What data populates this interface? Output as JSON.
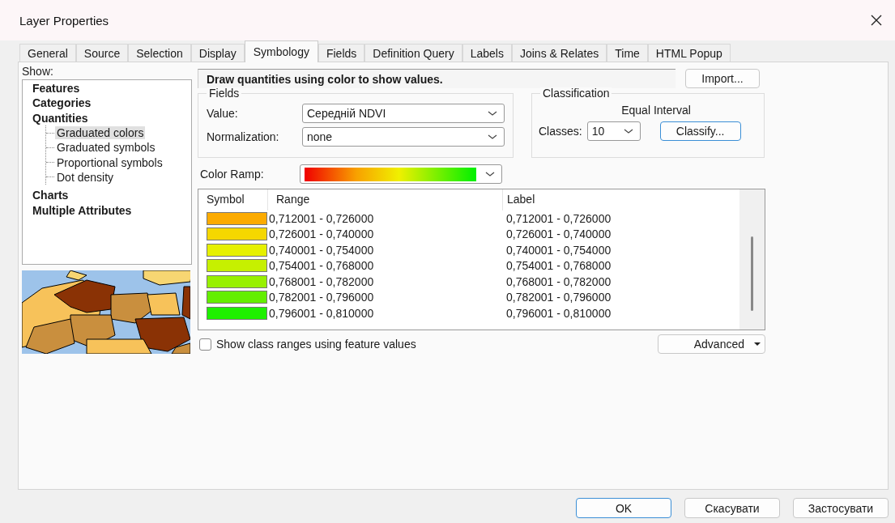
{
  "window": {
    "title": "Layer Properties"
  },
  "tabs": [
    {
      "label": "General",
      "selected": false
    },
    {
      "label": "Source",
      "selected": false
    },
    {
      "label": "Selection",
      "selected": false
    },
    {
      "label": "Display",
      "selected": false
    },
    {
      "label": "Symbology",
      "selected": true
    },
    {
      "label": "Fields",
      "selected": false
    },
    {
      "label": "Definition Query",
      "selected": false
    },
    {
      "label": "Labels",
      "selected": false
    },
    {
      "label": "Joins & Relates",
      "selected": false
    },
    {
      "label": "Time",
      "selected": false
    },
    {
      "label": "HTML Popup",
      "selected": false
    }
  ],
  "show": {
    "label": "Show:",
    "tree": [
      {
        "label": "Features",
        "selected": false
      },
      {
        "label": "Categories",
        "selected": false
      },
      {
        "label": "Quantities",
        "selected": false,
        "children": [
          {
            "label": "Graduated colors",
            "selected": true
          },
          {
            "label": "Graduated symbols",
            "selected": false
          },
          {
            "label": "Proportional symbols",
            "selected": false
          },
          {
            "label": "Dot density",
            "selected": false
          }
        ]
      },
      {
        "label": "Charts",
        "selected": false
      },
      {
        "label": "Multiple Attributes",
        "selected": false
      }
    ]
  },
  "description": "Draw quantities using color to show values.",
  "import_button": "Import...",
  "fields": {
    "title": "Fields",
    "value_label": "Value:",
    "value": "Середній NDVI",
    "normalization_label": "Normalization:",
    "normalization": "none"
  },
  "classification": {
    "title": "Classification",
    "method": "Equal Interval",
    "classes_label": "Classes:",
    "classes": "10",
    "classify_button": {
      "label": "Classify...",
      "focused": true
    }
  },
  "color_ramp": {
    "label": "Color Ramp:"
  },
  "table": {
    "columns": [
      "Symbol",
      "Range",
      "Label"
    ],
    "rows": [
      {
        "color": "#fcab00",
        "range": "0,712001 - 0,726000",
        "label": "0,712001 - 0,726000"
      },
      {
        "color": "#f5d700",
        "range": "0,726001 - 0,740000",
        "label": "0,726001 - 0,740000"
      },
      {
        "color": "#e6f000",
        "range": "0,740001 - 0,754000",
        "label": "0,740001 - 0,754000"
      },
      {
        "color": "#c6f000",
        "range": "0,754001 - 0,768000",
        "label": "0,754001 - 0,768000"
      },
      {
        "color": "#98f000",
        "range": "0,768001 - 0,782000",
        "label": "0,768001 - 0,782000"
      },
      {
        "color": "#64ee00",
        "range": "0,782001 - 0,796000",
        "label": "0,782001 - 0,796000"
      },
      {
        "color": "#1ef000",
        "range": "0,796001 - 0,810000",
        "label": "0,796001 - 0,810000"
      }
    ]
  },
  "show_class_ranges": {
    "label": "Show class ranges using feature values",
    "checked": false
  },
  "advanced_button": "Advanced",
  "buttons": [
    {
      "label": "OK",
      "focused": true
    },
    {
      "label": "Скасувати",
      "focused": false
    },
    {
      "label": "Застосувати",
      "focused": false
    }
  ]
}
